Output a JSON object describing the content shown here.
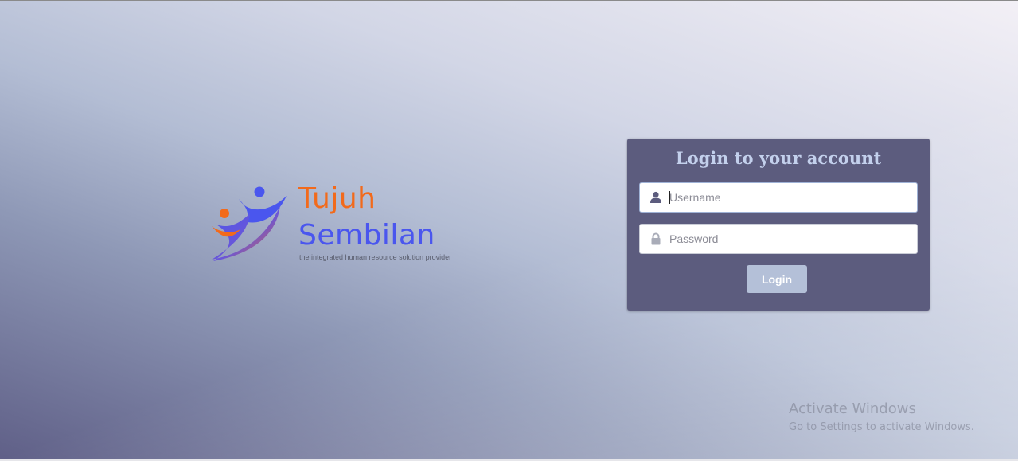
{
  "logo": {
    "line1": "Tujuh",
    "line2": "Sembilan",
    "tagline": "the integrated human resource solution provider",
    "colors": {
      "orange": "#f26a1b",
      "blue": "#4a56ee"
    }
  },
  "login": {
    "title": "Login to your account",
    "username_placeholder": "Username",
    "password_placeholder": "Password",
    "button_label": "Login",
    "username_icon": "user-icon",
    "password_icon": "lock-icon"
  },
  "watermark": {
    "line1": "Activate Windows",
    "line2": "Go to Settings to activate Windows."
  },
  "colors": {
    "card_bg": "#5c5c7e",
    "title": "#c3d0ec",
    "button_bg": "#b4c0d8"
  }
}
